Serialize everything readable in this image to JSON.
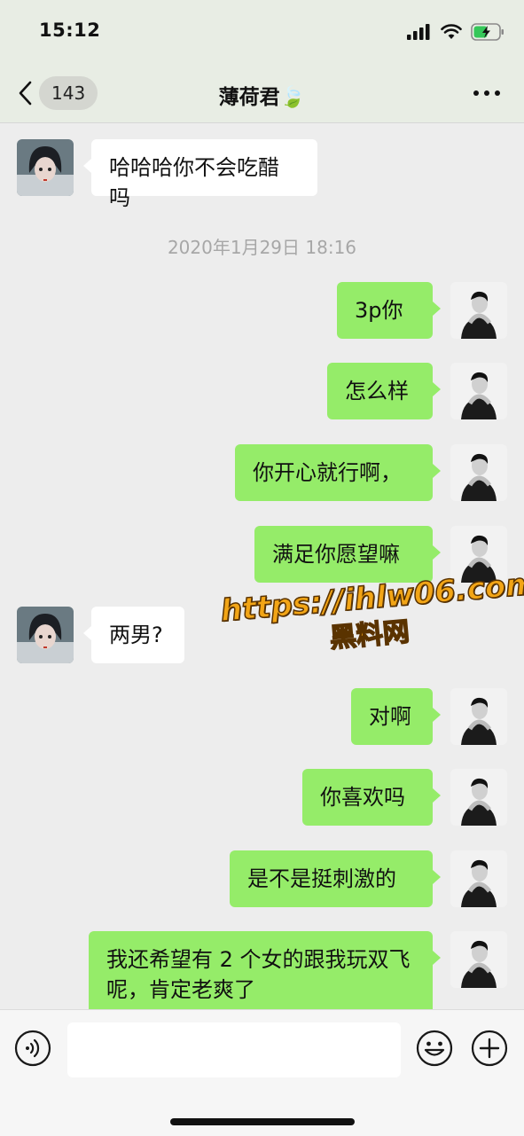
{
  "status": {
    "time": "15:12"
  },
  "nav": {
    "back_badge": "143",
    "title": "薄荷君",
    "title_emoji": "🍃"
  },
  "messages": [
    {
      "side": "in",
      "text": "哈哈哈你不会吃醋吗"
    },
    {
      "side": "out",
      "text": "3p你"
    },
    {
      "side": "out",
      "text": "怎么样"
    },
    {
      "side": "out",
      "text": "你开心就行啊，"
    },
    {
      "side": "out",
      "text": "满足你愿望嘛"
    },
    {
      "side": "in",
      "text": "两男?"
    },
    {
      "side": "out",
      "text": "对啊"
    },
    {
      "side": "out",
      "text": "你喜欢吗"
    },
    {
      "side": "out",
      "text": "是不是挺刺激的"
    },
    {
      "side": "out",
      "text": "我还希望有 2 个女的跟我玩双飞呢，肯定老爽了"
    }
  ],
  "timestamp": "2020年1月29日 18:16",
  "watermark": {
    "url": "https://ihlw06.com",
    "name": "黑料网"
  },
  "input": {
    "value": ""
  },
  "colors": {
    "outgoing_bubble": "#95ec69",
    "incoming_bubble": "#ffffff",
    "background": "#ededed",
    "watermark": "#f2a516"
  }
}
